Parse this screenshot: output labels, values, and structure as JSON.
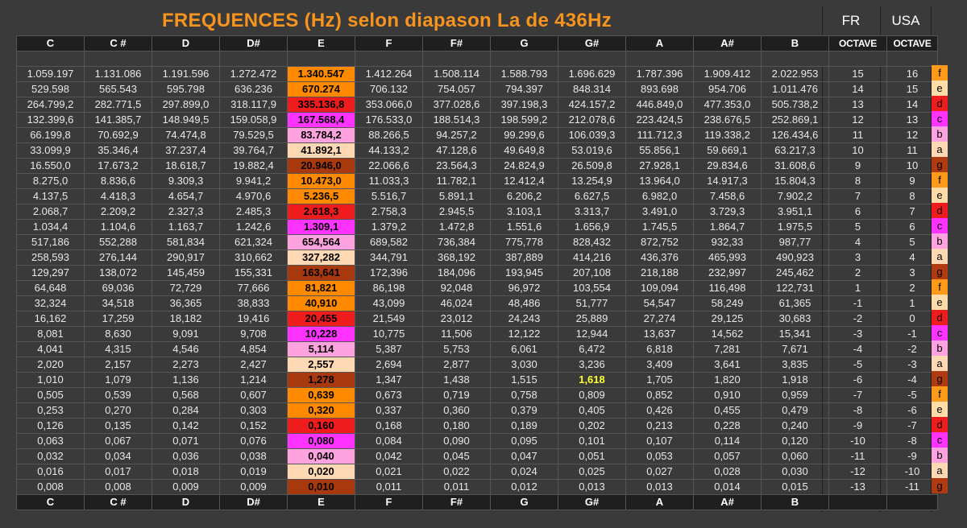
{
  "title": "FREQUENCES  (Hz) selon diapason La de 436Hz",
  "fr_label": "FR",
  "usa_label": "USA",
  "headers": [
    "C",
    "C #",
    "D",
    "D#",
    "E",
    "F",
    "F#",
    "G",
    "G#",
    "A",
    "A#",
    "B",
    "OCTAVE",
    "OCTAVE"
  ],
  "footer": [
    "C",
    "C #",
    "D",
    "D#",
    "E",
    "F",
    "F#",
    "G",
    "G#",
    "A",
    "A#",
    "B",
    "",
    ""
  ],
  "rows": [
    {
      "v": [
        "1.059.197",
        "1.131.086",
        "1.191.596",
        "1.272.472",
        "1.340.547",
        "1.412.264",
        "1.508.114",
        "1.588.793",
        "1.696.629",
        "1.787.396",
        "1.909.412",
        "2.022.953",
        "15",
        "16"
      ],
      "letter": "f"
    },
    {
      "v": [
        "529.598",
        "565.543",
        "595.798",
        "636.236",
        "670.274",
        "706.132",
        "754.057",
        "794.397",
        "848.314",
        "893.698",
        "954.706",
        "1.011.476",
        "14",
        "15"
      ],
      "letter": "e"
    },
    {
      "v": [
        "264.799,2",
        "282.771,5",
        "297.899,0",
        "318.117,9",
        "335.136,8",
        "353.066,0",
        "377.028,6",
        "397.198,3",
        "424.157,2",
        "446.849,0",
        "477.353,0",
        "505.738,2",
        "13",
        "14"
      ],
      "letter": "d"
    },
    {
      "v": [
        "132.399,6",
        "141.385,7",
        "148.949,5",
        "159.058,9",
        "167.568,4",
        "176.533,0",
        "188.514,3",
        "198.599,2",
        "212.078,6",
        "223.424,5",
        "238.676,5",
        "252.869,1",
        "12",
        "13"
      ],
      "letter": "c"
    },
    {
      "v": [
        "66.199,8",
        "70.692,9",
        "74.474,8",
        "79.529,5",
        "83.784,2",
        "88.266,5",
        "94.257,2",
        "99.299,6",
        "106.039,3",
        "111.712,3",
        "119.338,2",
        "126.434,6",
        "11",
        "12"
      ],
      "letter": "b"
    },
    {
      "v": [
        "33.099,9",
        "35.346,4",
        "37.237,4",
        "39.764,7",
        "41.892,1",
        "44.133,2",
        "47.128,6",
        "49.649,8",
        "53.019,6",
        "55.856,1",
        "59.669,1",
        "63.217,3",
        "10",
        "11"
      ],
      "letter": "a"
    },
    {
      "v": [
        "16.550,0",
        "17.673,2",
        "18.618,7",
        "19.882,4",
        "20.946,0",
        "22.066,6",
        "23.564,3",
        "24.824,9",
        "26.509,8",
        "27.928,1",
        "29.834,6",
        "31.608,6",
        "9",
        "10"
      ],
      "letter": "g"
    },
    {
      "v": [
        "8.275,0",
        "8.836,6",
        "9.309,3",
        "9.941,2",
        "10.473,0",
        "11.033,3",
        "11.782,1",
        "12.412,4",
        "13.254,9",
        "13.964,0",
        "14.917,3",
        "15.804,3",
        "8",
        "9"
      ],
      "letter": "f"
    },
    {
      "v": [
        "4.137,5",
        "4.418,3",
        "4.654,7",
        "4.970,6",
        "5.236,5",
        "5.516,7",
        "5.891,1",
        "6.206,2",
        "6.627,5",
        "6.982,0",
        "7.458,6",
        "7.902,2",
        "7",
        "8"
      ],
      "letter": "e"
    },
    {
      "v": [
        "2.068,7",
        "2.209,2",
        "2.327,3",
        "2.485,3",
        "2.618,3",
        "2.758,3",
        "2.945,5",
        "3.103,1",
        "3.313,7",
        "3.491,0",
        "3.729,3",
        "3.951,1",
        "6",
        "7"
      ],
      "letter": "d"
    },
    {
      "v": [
        "1.034,4",
        "1.104,6",
        "1.163,7",
        "1.242,6",
        "1.309,1",
        "1.379,2",
        "1.472,8",
        "1.551,6",
        "1.656,9",
        "1.745,5",
        "1.864,7",
        "1.975,5",
        "5",
        "6"
      ],
      "letter": "c"
    },
    {
      "v": [
        "517,186",
        "552,288",
        "581,834",
        "621,324",
        "654,564",
        "689,582",
        "736,384",
        "775,778",
        "828,432",
        "872,752",
        "932,33",
        "987,77",
        "4",
        "5"
      ],
      "letter": "b"
    },
    {
      "v": [
        "258,593",
        "276,144",
        "290,917",
        "310,662",
        "327,282",
        "344,791",
        "368,192",
        "387,889",
        "414,216",
        "436,376",
        "465,993",
        "490,923",
        "3",
        "4"
      ],
      "letter": "a"
    },
    {
      "v": [
        "129,297",
        "138,072",
        "145,459",
        "155,331",
        "163,641",
        "172,396",
        "184,096",
        "193,945",
        "207,108",
        "218,188",
        "232,997",
        "245,462",
        "2",
        "3"
      ],
      "letter": "g"
    },
    {
      "v": [
        "64,648",
        "69,036",
        "72,729",
        "77,666",
        "81,821",
        "86,198",
        "92,048",
        "96,972",
        "103,554",
        "109,094",
        "116,498",
        "122,731",
        "1",
        "2"
      ],
      "letter": "f"
    },
    {
      "v": [
        "32,324",
        "34,518",
        "36,365",
        "38,833",
        "40,910",
        "43,099",
        "46,024",
        "48,486",
        "51,777",
        "54,547",
        "58,249",
        "61,365",
        "-1",
        "1"
      ],
      "letter": "e"
    },
    {
      "v": [
        "16,162",
        "17,259",
        "18,182",
        "19,416",
        "20,455",
        "21,549",
        "23,012",
        "24,243",
        "25,889",
        "27,274",
        "29,125",
        "30,683",
        "-2",
        "0"
      ],
      "letter": "d"
    },
    {
      "v": [
        "8,081",
        "8,630",
        "9,091",
        "9,708",
        "10,228",
        "10,775",
        "11,506",
        "12,122",
        "12,944",
        "13,637",
        "14,562",
        "15,341",
        "-3",
        "-1"
      ],
      "letter": "c"
    },
    {
      "v": [
        "4,041",
        "4,315",
        "4,546",
        "4,854",
        "5,114",
        "5,387",
        "5,753",
        "6,061",
        "6,472",
        "6,818",
        "7,281",
        "7,671",
        "-4",
        "-2"
      ],
      "letter": "b"
    },
    {
      "v": [
        "2,020",
        "2,157",
        "2,273",
        "2,427",
        "2,557",
        "2,694",
        "2,877",
        "3,030",
        "3,236",
        "3,409",
        "3,641",
        "3,835",
        "-5",
        "-3"
      ],
      "letter": "a"
    },
    {
      "v": [
        "1,010",
        "1,079",
        "1,136",
        "1,214",
        "1,278",
        "1,347",
        "1,438",
        "1,515",
        "1,618",
        "1,705",
        "1,820",
        "1,918",
        "-6",
        "-4"
      ],
      "letter": "g"
    },
    {
      "v": [
        "0,505",
        "0,539",
        "0,568",
        "0,607",
        "0,639",
        "0,673",
        "0,719",
        "0,758",
        "0,809",
        "0,852",
        "0,910",
        "0,959",
        "-7",
        "-5"
      ],
      "letter": "f"
    },
    {
      "v": [
        "0,253",
        "0,270",
        "0,284",
        "0,303",
        "0,320",
        "0,337",
        "0,360",
        "0,379",
        "0,405",
        "0,426",
        "0,455",
        "0,479",
        "-8",
        "-6"
      ],
      "letter": "e"
    },
    {
      "v": [
        "0,126",
        "0,135",
        "0,142",
        "0,152",
        "0,160",
        "0,168",
        "0,180",
        "0,189",
        "0,202",
        "0,213",
        "0,228",
        "0,240",
        "-9",
        "-7"
      ],
      "letter": "d"
    },
    {
      "v": [
        "0,063",
        "0,067",
        "0,071",
        "0,076",
        "0,080",
        "0,084",
        "0,090",
        "0,095",
        "0,101",
        "0,107",
        "0,114",
        "0,120",
        "-10",
        "-8"
      ],
      "letter": "c"
    },
    {
      "v": [
        "0,032",
        "0,034",
        "0,036",
        "0,038",
        "0,040",
        "0,042",
        "0,045",
        "0,047",
        "0,051",
        "0,053",
        "0,057",
        "0,060",
        "-11",
        "-9"
      ],
      "letter": "b"
    },
    {
      "v": [
        "0,016",
        "0,017",
        "0,018",
        "0,019",
        "0,020",
        "0,021",
        "0,022",
        "0,024",
        "0,025",
        "0,027",
        "0,028",
        "0,030",
        "-12",
        "-10"
      ],
      "letter": "a"
    },
    {
      "v": [
        "0,008",
        "0,008",
        "0,009",
        "0,009",
        "0,010",
        "0,011",
        "0,011",
        "0,012",
        "0,013",
        "0,013",
        "0,014",
        "0,015",
        "-13",
        "-11"
      ],
      "letter": "g"
    }
  ],
  "highlight": {
    "row": 20,
    "col": 8,
    "color": "#ffff33"
  },
  "letter_colors": {
    "f": "#ff9a1a",
    "e": "#ffdca8",
    "d": "#ee1c1c",
    "c": "#ff33ff",
    "b": "#ffa3e0",
    "a": "#ffd9b3",
    "g": "#b03a12"
  },
  "e_column_colors": {
    "f": "#ff8a00",
    "e": "#ff8a00",
    "d": "#ee1c1c",
    "c": "#ff33ff",
    "b": "#ffa3e0",
    "a": "#ffd9b3",
    "g": "#a8390f"
  }
}
